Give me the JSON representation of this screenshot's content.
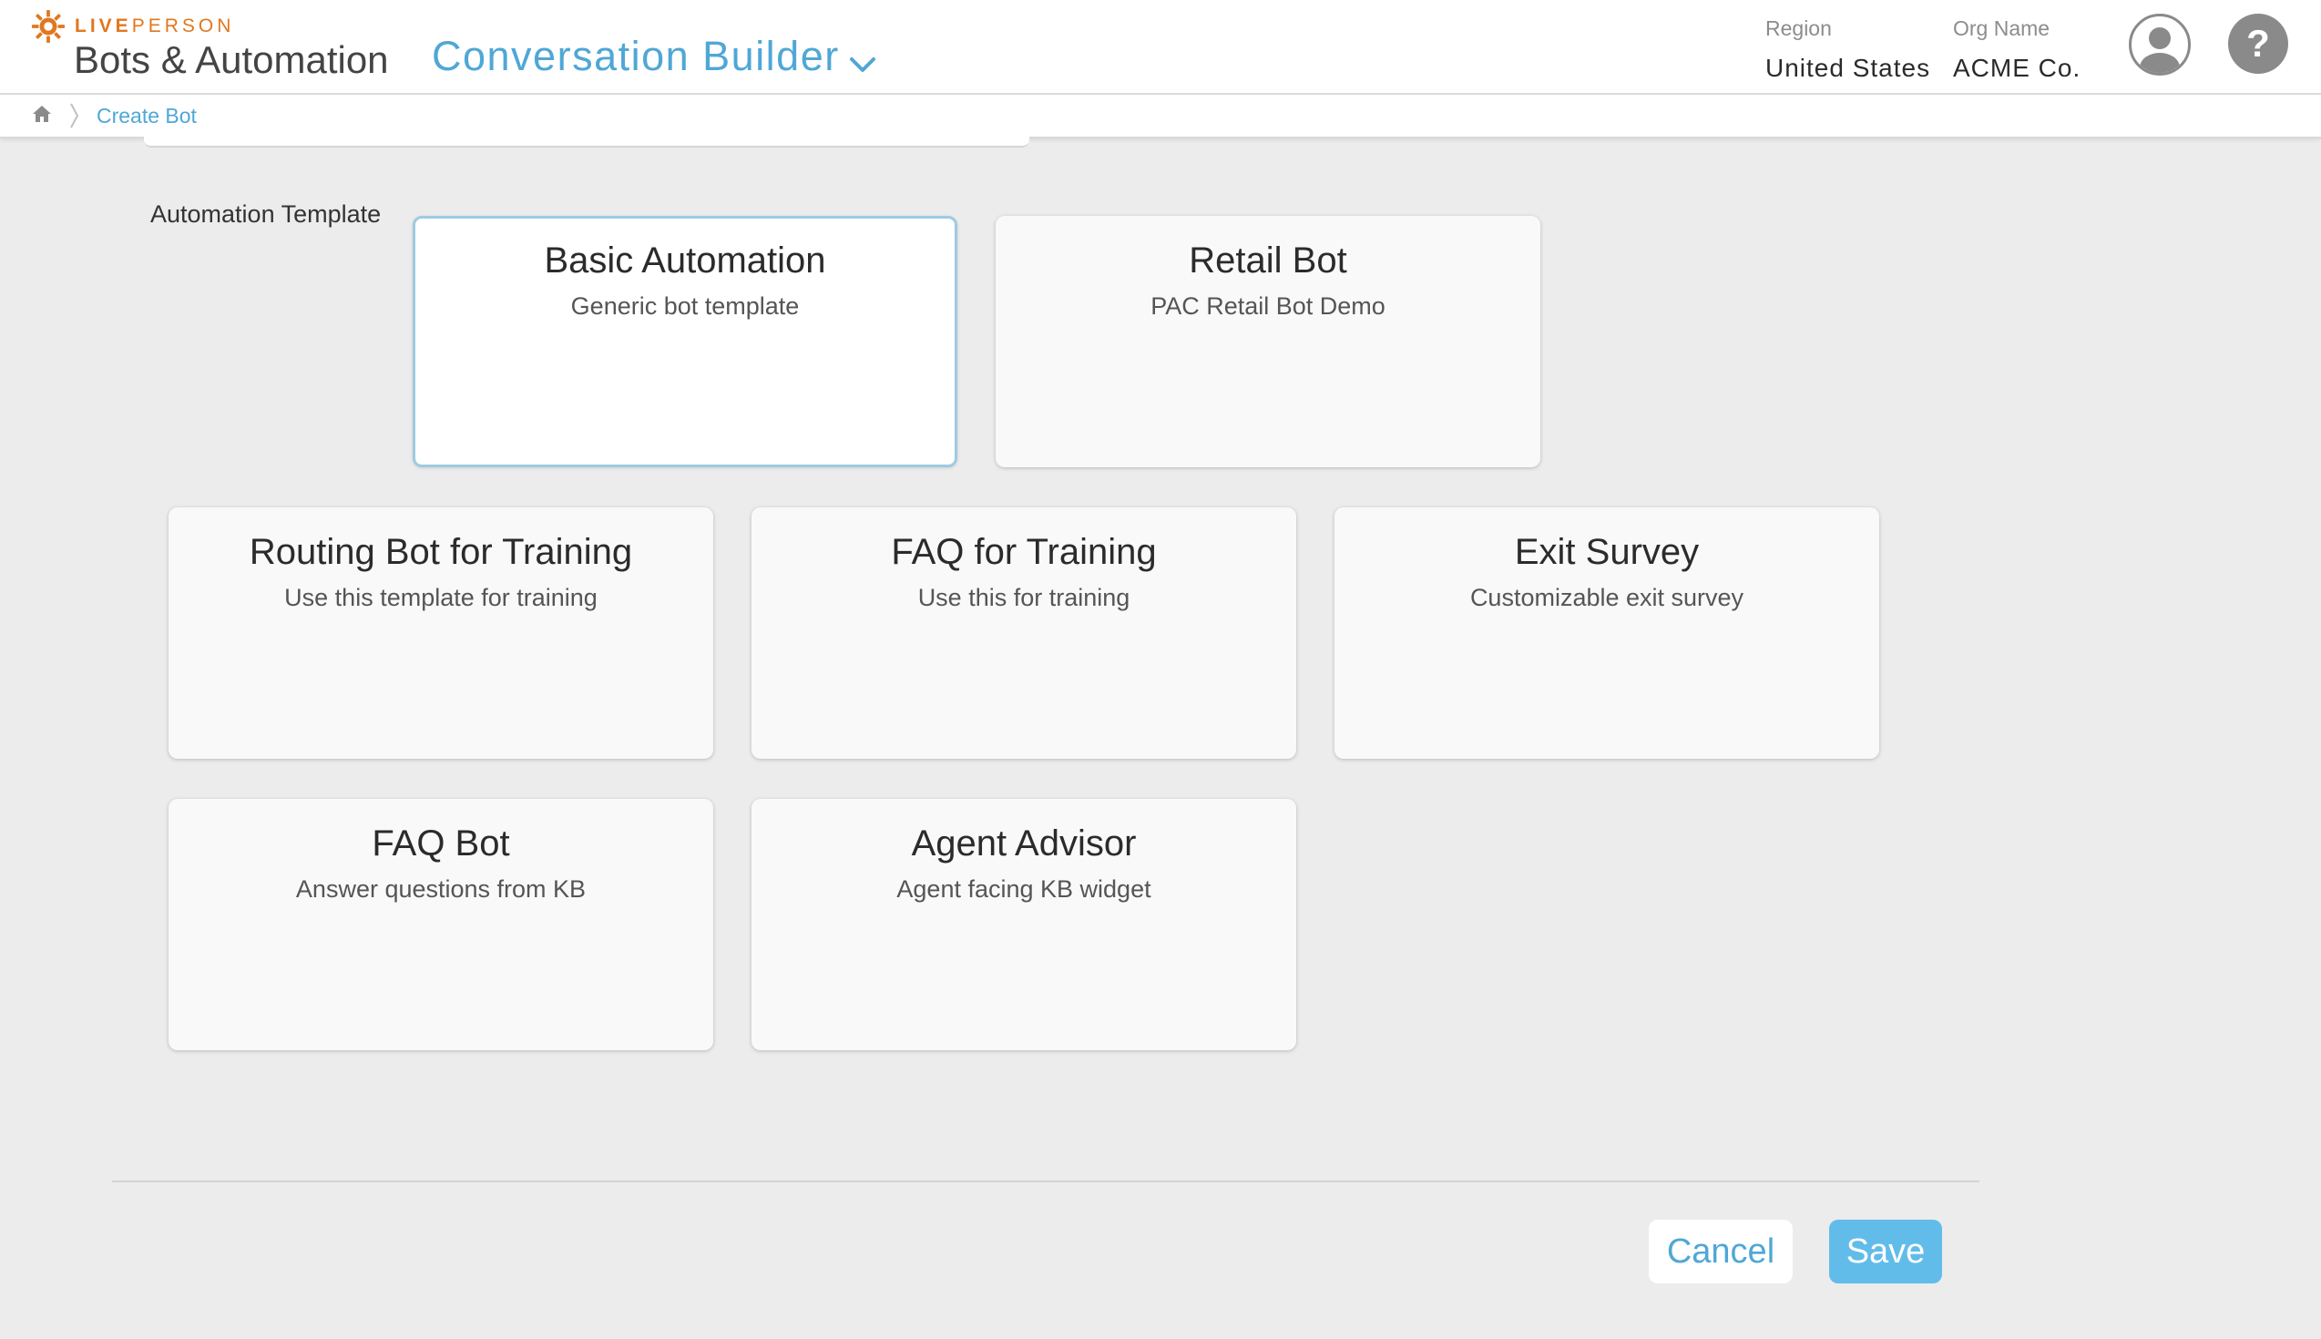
{
  "header": {
    "brand": "LIVEPERSON",
    "brand_bold": "LIVE",
    "brand_light": "PERSON",
    "product": "Bots & Automation",
    "app_switcher": "Conversation Builder",
    "region_label": "Region",
    "region_value": "United States",
    "org_label": "Org Name",
    "org_value": "ACME Co.",
    "help_glyph": "?"
  },
  "breadcrumb": {
    "home_icon": "home-icon",
    "current": "Create Bot"
  },
  "section": {
    "label": "Automation Template"
  },
  "templates": [
    {
      "title": "Basic Automation",
      "subtitle": "Generic bot template",
      "selected": true
    },
    {
      "title": "Retail Bot",
      "subtitle": "PAC Retail Bot Demo",
      "selected": false
    },
    {
      "title": "Routing Bot for Training",
      "subtitle": "Use this template for training",
      "selected": false
    },
    {
      "title": "FAQ for Training",
      "subtitle": "Use this for training",
      "selected": false
    },
    {
      "title": "Exit Survey",
      "subtitle": "Customizable exit survey",
      "selected": false
    },
    {
      "title": "FAQ Bot",
      "subtitle": "Answer questions from KB",
      "selected": false
    },
    {
      "title": "Agent Advisor",
      "subtitle": "Agent facing KB widget",
      "selected": false
    }
  ],
  "footer": {
    "cancel_label": "Cancel",
    "save_label": "Save"
  },
  "colors": {
    "accent": "#4fa7d6",
    "brand_orange": "#e1771f",
    "save_button": "#62bce9",
    "selected_border": "#9ecbe2"
  }
}
